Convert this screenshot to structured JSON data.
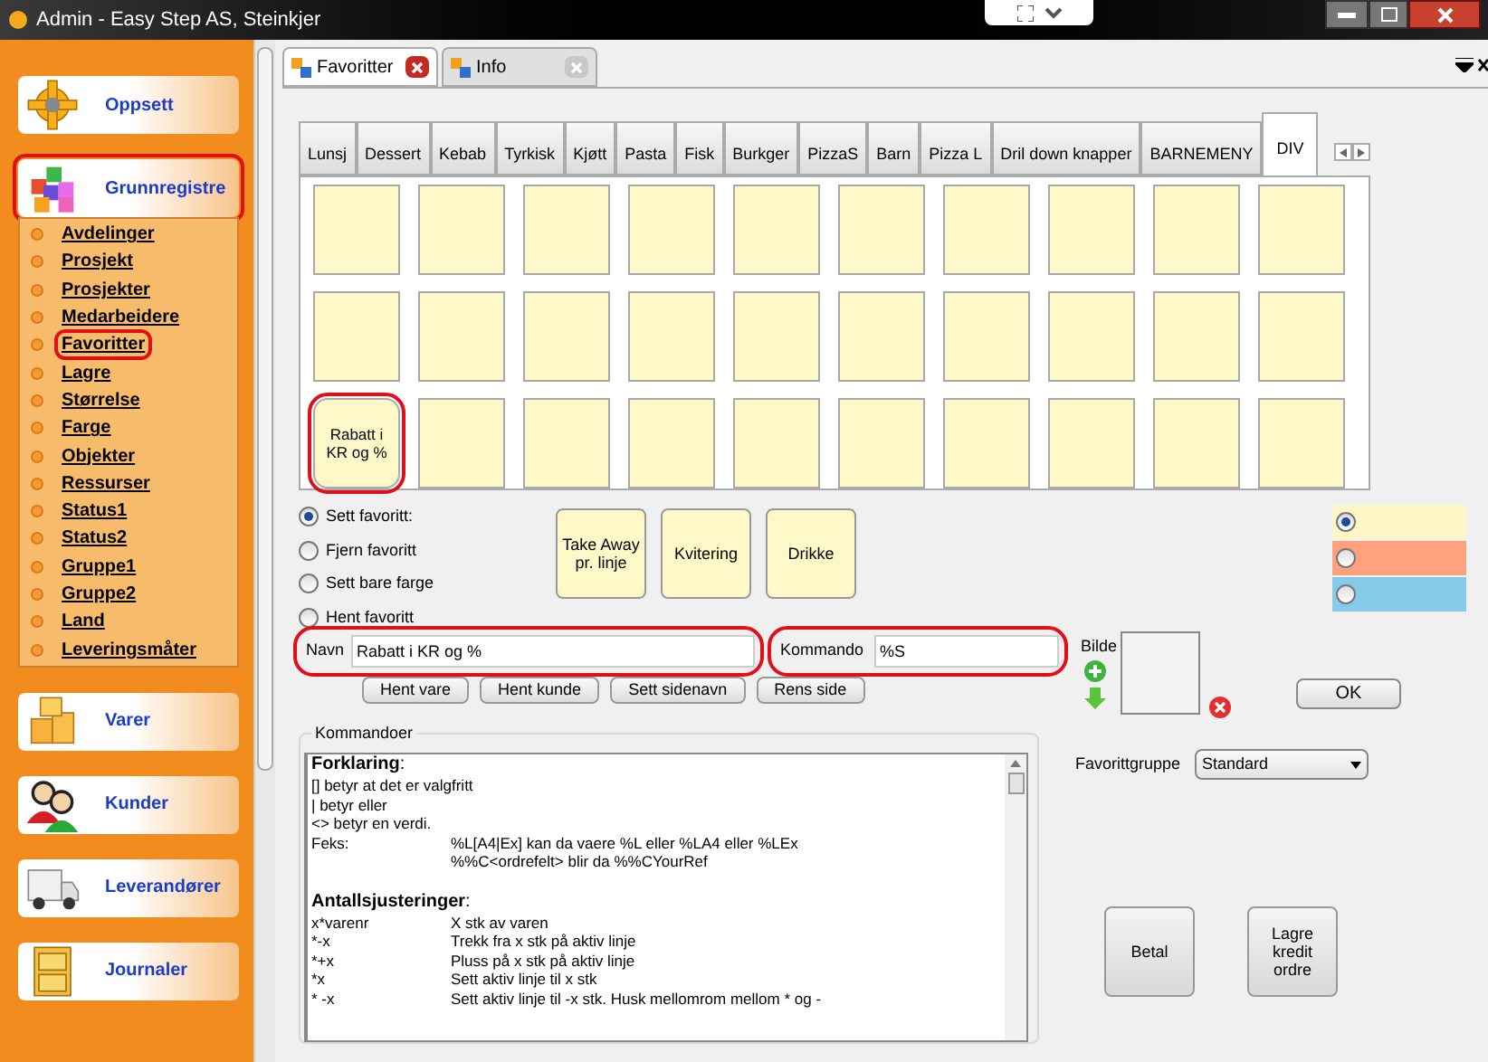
{
  "window": {
    "title": "Admin - Easy Step AS, Steinkjer"
  },
  "sidebar": {
    "sections": [
      {
        "label": "Oppsett",
        "kind": "gear",
        "circled": false
      },
      {
        "label": "Grunnregistre",
        "kind": "cubes",
        "circled": true,
        "expanded": true,
        "items": [
          {
            "label": "Avdelinger",
            "circled": false
          },
          {
            "label": "Prosjekt",
            "circled": false
          },
          {
            "label": "Prosjekter",
            "circled": false
          },
          {
            "label": "Medarbeidere",
            "circled": false
          },
          {
            "label": "Favoritter",
            "circled": true
          },
          {
            "label": "Lagre",
            "circled": false
          },
          {
            "label": "Størrelse",
            "circled": false
          },
          {
            "label": "Farge",
            "circled": false
          },
          {
            "label": "Objekter",
            "circled": false
          },
          {
            "label": "Ressurser",
            "circled": false
          },
          {
            "label": "Status1",
            "circled": false
          },
          {
            "label": "Status2",
            "circled": false
          },
          {
            "label": "Gruppe1",
            "circled": false
          },
          {
            "label": "Gruppe2",
            "circled": false
          },
          {
            "label": "Land",
            "circled": false
          },
          {
            "label": "Leveringsmåter",
            "circled": false
          }
        ]
      },
      {
        "label": "Varer",
        "kind": "boxes",
        "circled": false
      },
      {
        "label": "Kunder",
        "kind": "people",
        "circled": false
      },
      {
        "label": "Leverandører",
        "kind": "truck",
        "circled": false
      },
      {
        "label": "Journaler",
        "kind": "cabinet",
        "circled": false
      }
    ]
  },
  "doc_tabs": [
    {
      "label": "Favoritter",
      "selected": true
    },
    {
      "label": "Info",
      "selected": false
    }
  ],
  "page_tabs": [
    {
      "label": "Lunsj",
      "selected": false
    },
    {
      "label": "Dessert",
      "selected": false
    },
    {
      "label": "Kebab",
      "selected": false
    },
    {
      "label": "Tyrkisk",
      "selected": false
    },
    {
      "label": "Kjøtt",
      "selected": false
    },
    {
      "label": "Pasta",
      "selected": false
    },
    {
      "label": "Fisk",
      "selected": false
    },
    {
      "label": "Burkger",
      "selected": false
    },
    {
      "label": "PizzaS",
      "selected": false
    },
    {
      "label": "Barn",
      "selected": false
    },
    {
      "label": "Pizza L",
      "selected": false
    },
    {
      "label": "Dril down knapper",
      "selected": false
    },
    {
      "label": "BARNEMENY",
      "selected": false
    },
    {
      "label": "DIV",
      "selected": true
    }
  ],
  "grid": [
    [
      {
        "kind": "empty"
      },
      {
        "kind": "empty"
      },
      {
        "kind": "empty"
      },
      {
        "kind": "empty"
      },
      {
        "kind": "empty"
      },
      {
        "kind": "empty"
      },
      {
        "kind": "empty"
      },
      {
        "kind": "empty"
      },
      {
        "kind": "empty"
      },
      {
        "kind": "empty"
      }
    ],
    [
      {
        "kind": "empty"
      },
      {
        "kind": "empty"
      },
      {
        "kind": "empty"
      },
      {
        "kind": "empty"
      },
      {
        "kind": "empty"
      },
      {
        "kind": "empty"
      },
      {
        "kind": "empty"
      },
      {
        "kind": "empty"
      },
      {
        "kind": "empty"
      },
      {
        "kind": "empty"
      }
    ],
    [
      {
        "kind": "label",
        "label": "Rabatt i KR og %",
        "circled": true
      },
      {
        "kind": "empty"
      },
      {
        "kind": "empty"
      },
      {
        "kind": "empty"
      },
      {
        "kind": "empty"
      },
      {
        "kind": "empty"
      },
      {
        "kind": "empty"
      },
      {
        "kind": "empty"
      },
      {
        "kind": "empty"
      },
      {
        "kind": "empty"
      }
    ]
  ],
  "modes": [
    {
      "label": "Sett favoritt:",
      "selected": true
    },
    {
      "label": "Fjern favoritt",
      "selected": false
    },
    {
      "label": "Sett bare farge",
      "selected": false
    },
    {
      "label": "Hent favoritt",
      "selected": false
    }
  ],
  "quick_buttons": [
    "Take Away pr. linje",
    "Kvitering",
    "Drikke"
  ],
  "colors": [
    {
      "color": "#fff7c8",
      "selected": true
    },
    {
      "color": "#fea17c",
      "selected": false
    },
    {
      "color": "#86cbe9",
      "selected": false
    }
  ],
  "navn": {
    "label": "Navn",
    "value": "Rabatt i KR og %",
    "circled": true
  },
  "kommando": {
    "label": "Kommando",
    "value": "%S",
    "circled": true
  },
  "bilde": {
    "label": "Bilde"
  },
  "action_buttons": [
    "Hent vare",
    "Hent kunde",
    "Sett sidenavn",
    "Rens side"
  ],
  "ok_button": "OK",
  "commands": {
    "title": "Kommandoer",
    "lines": [
      {
        "kind": "heading",
        "text": "**Forklaring**:"
      },
      {
        "kind": "text",
        "text": "[] betyr at det er valgfritt"
      },
      {
        "kind": "text",
        "text": "| betyr eller"
      },
      {
        "kind": "text",
        "text": "<> betyr en verdi."
      },
      {
        "kind": "pair",
        "key": "Feks:",
        "text": "%L[A4|Ex] kan da vaere %L eller %LA4 eller %LEx"
      },
      {
        "kind": "pair",
        "text": "%%C<ordrefelt> blir da %%CYourRef"
      },
      {
        "kind": "blank"
      },
      {
        "kind": "heading",
        "text": "**Antallsjusteringer**:"
      },
      {
        "kind": "pair",
        "key": "x*varenr",
        "text": "X stk av varen"
      },
      {
        "kind": "pair",
        "key": "*-x",
        "text": "Trekk fra x stk på aktiv linje"
      },
      {
        "kind": "pair",
        "key": "*+x",
        "text": "Pluss på x stk på aktiv linje"
      },
      {
        "kind": "pair",
        "key": "*x",
        "text": "Sett aktiv linje til x stk"
      },
      {
        "kind": "pair",
        "key": "* -x",
        "text": "Sett aktiv linje til -x stk. Husk mellomrom mellom * og -"
      }
    ]
  },
  "favorittgruppe": {
    "label": "Favorittgruppe",
    "value": "Standard"
  },
  "bottom_buttons": [
    "Betal",
    "Lagre kredit ordre"
  ]
}
